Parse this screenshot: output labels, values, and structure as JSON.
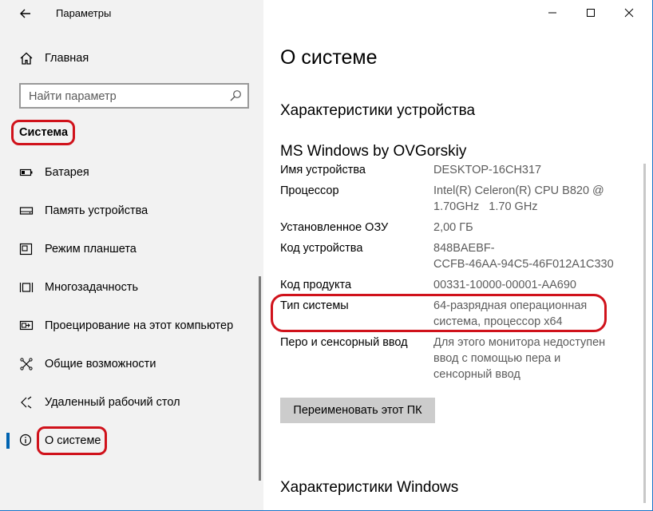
{
  "window": {
    "title": "Параметры"
  },
  "sidebar": {
    "home_label": "Главная",
    "search_placeholder": "Найти параметр",
    "section_header": "Система",
    "items": [
      {
        "label": "Батарея",
        "icon": "battery-icon"
      },
      {
        "label": "Память устройства",
        "icon": "storage-icon"
      },
      {
        "label": "Режим планшета",
        "icon": "tablet-mode-icon"
      },
      {
        "label": "Многозадачность",
        "icon": "multitasking-icon"
      },
      {
        "label": "Проецирование на этот компьютер",
        "icon": "projecting-icon"
      },
      {
        "label": "Общие возможности",
        "icon": "shared-experiences-icon"
      },
      {
        "label": "Удаленный рабочий стол",
        "icon": "remote-desktop-icon"
      },
      {
        "label": "О системе",
        "icon": "info-icon",
        "selected": true
      }
    ]
  },
  "main": {
    "page_title": "О системе",
    "device_section_title": "Характеристики устройства",
    "device_name": "MS Windows by OVGorskiy",
    "specs": [
      {
        "key": "Имя устройства",
        "value": "DESKTOP-16CH317"
      },
      {
        "key": "Процессор",
        "value_lines": [
          "Intel(R) Celeron(R) CPU B820 @",
          "1.70GHz   1.70 GHz"
        ]
      },
      {
        "key": "Установленное ОЗУ",
        "value": "2,00 ГБ"
      },
      {
        "key": "Код устройства",
        "value_lines": [
          "848BAEBF-",
          "CCFB-46AA-94C5-46F012A1C330"
        ]
      },
      {
        "key": "Код продукта",
        "value": "00331-10000-00001-AA690"
      },
      {
        "key": "Тип системы",
        "value_lines": [
          "64-разрядная операционная",
          "система, процессор x64"
        ]
      },
      {
        "key": "Перо и сенсорный ввод",
        "value_lines": [
          "Для этого монитора недоступен",
          "ввод с помощью пера и",
          "сенсорный ввод"
        ]
      }
    ],
    "rename_button": "Переименовать этот ПК",
    "windows_section_title": "Характеристики Windows"
  },
  "colors": {
    "sidebar_bg": "#f2f2f2",
    "accent": "#0063b1",
    "highlight_red": "#d0121b",
    "value_gray": "#5c5c5c"
  }
}
